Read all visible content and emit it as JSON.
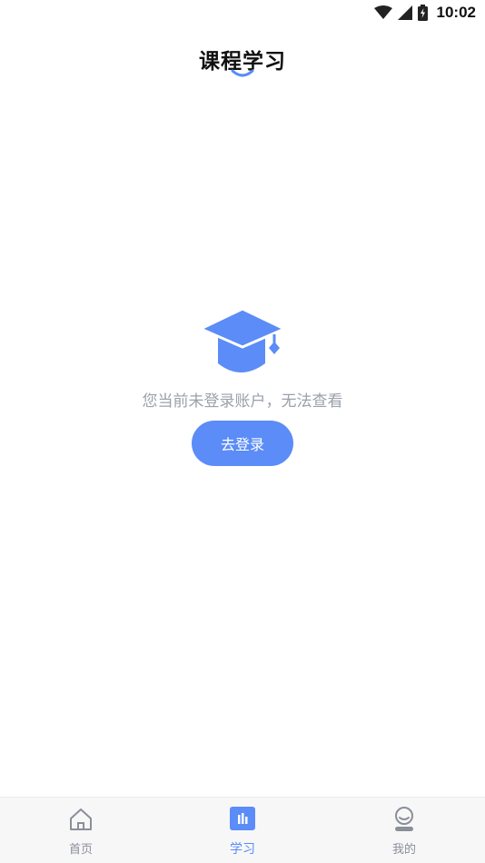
{
  "status_bar": {
    "time": "10:02",
    "icons": [
      "wifi-icon",
      "signal-icon",
      "battery-charging-icon"
    ]
  },
  "header": {
    "title": "课程学习"
  },
  "empty_state": {
    "icon": "graduation-cap-icon",
    "message": "您当前未登录账户，无法查看",
    "button_label": "去登录"
  },
  "tab_bar": {
    "tabs": [
      {
        "label": "首页",
        "icon": "home-icon",
        "active": false
      },
      {
        "label": "学习",
        "icon": "chart-icon",
        "active": true
      },
      {
        "label": "我的",
        "icon": "user-icon",
        "active": false
      }
    ]
  },
  "colors": {
    "accent": "#5b8cf7",
    "muted_text": "#9aa1ab",
    "tab_inactive": "#8a8f98"
  }
}
